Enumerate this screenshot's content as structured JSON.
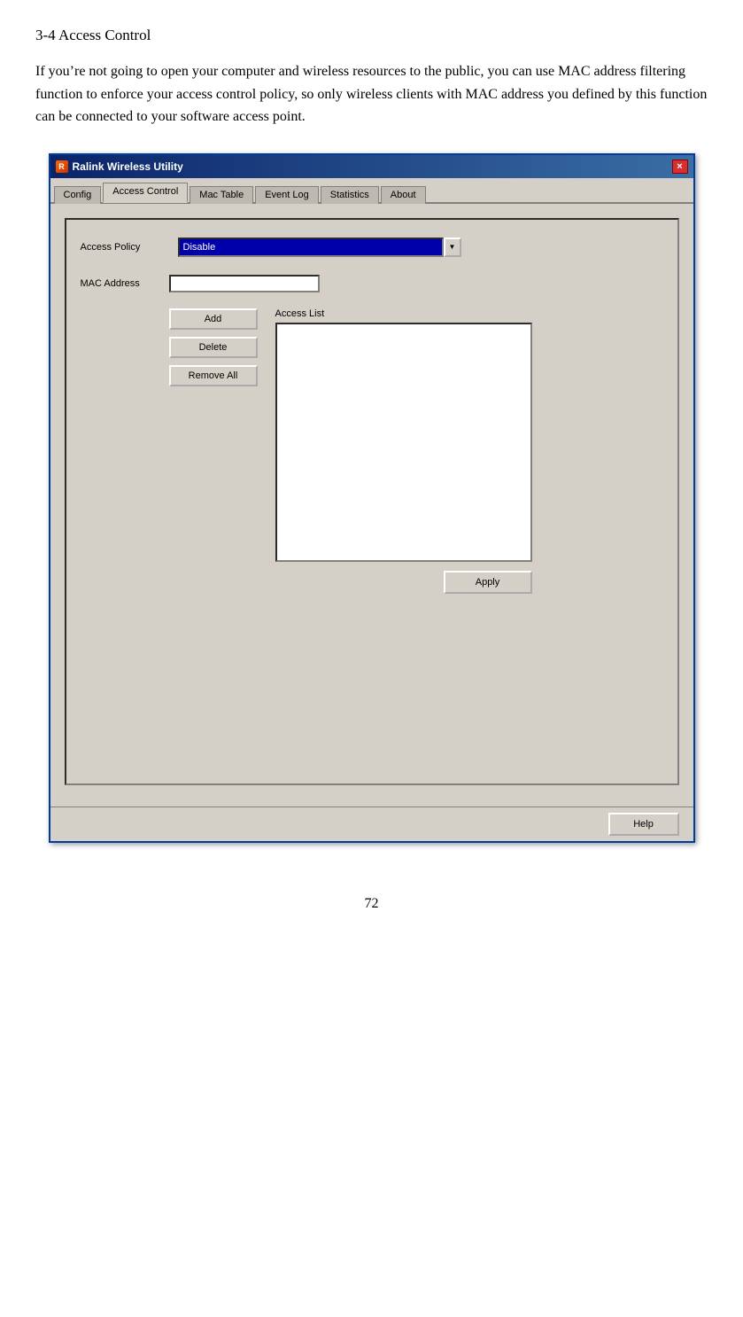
{
  "heading": "3-4 Access Control",
  "body_text": "If you’re not going to open your computer and wireless resources to the public, you can use MAC address filtering function to enforce your access control policy, so only wireless clients with MAC address you defined by this function can be connected to your software access point.",
  "dialog": {
    "title": "Ralink Wireless Utility",
    "close_btn": "×",
    "tabs": [
      {
        "label": "Config",
        "active": false
      },
      {
        "label": "Access Control",
        "active": true
      },
      {
        "label": "Mac Table",
        "active": false
      },
      {
        "label": "Event Log",
        "active": false
      },
      {
        "label": "Statistics",
        "active": false
      },
      {
        "label": "About",
        "active": false
      }
    ],
    "form": {
      "access_policy_label": "Access Policy",
      "access_policy_value": "Disable",
      "mac_address_label": "MAC Address",
      "mac_address_value": "",
      "access_list_label": "Access List",
      "add_btn": "Add",
      "delete_btn": "Delete",
      "remove_all_btn": "Remove All",
      "apply_btn": "Apply",
      "help_btn": "Help"
    }
  },
  "page_number": "72"
}
